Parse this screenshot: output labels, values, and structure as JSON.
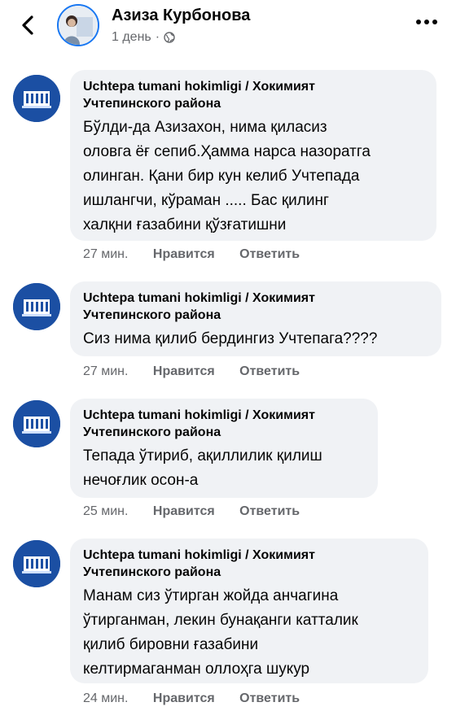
{
  "header": {
    "name": "Азиза Курбонова",
    "time": "1 день",
    "separator": "·",
    "icons": {
      "back": "chevron-left-icon",
      "privacy": "globe-icon",
      "more": "more-dots-icon"
    }
  },
  "colors": {
    "bubble": "#f0f2f5",
    "muted": "#65676b",
    "avatar": "#1b4fa3",
    "accent": "#1877f2"
  },
  "comments": [
    {
      "author": "Uchtepa tumani hokimligi / Хокимият\nУчтепинского района",
      "text": "Бўлди-да Азизахон, нима қиласиз\nоловга ёғ сепиб.Ҳамма нарса назоратга\nолинган. Қани бир кун келиб Учтепада\nишлангчи, кўраман ..... Бас қилинг\nхалқни ғазабини қўзғатишни",
      "time": "27 мин.",
      "like": "Нравится",
      "reply": "Ответить"
    },
    {
      "author": "Uchtepa tumani hokimligi / Хокимият\nУчтепинского района",
      "text": "Сиз нима қилиб бердингиз Учтепага????",
      "time": "27 мин.",
      "like": "Нравится",
      "reply": "Ответить"
    },
    {
      "author": "Uchtepa tumani hokimligi / Хокимият\nУчтепинского района",
      "text": "Тепада ўтириб, ақиллилик қилиш\nнечоғлик осон-а",
      "time": "25 мин.",
      "like": "Нравится",
      "reply": "Ответить"
    },
    {
      "author": "Uchtepa tumani hokimligi / Хокимият\nУчтепинского района",
      "text": "Манам сиз ўтирган жойда анчагина\nўтирганман, лекин бунақанги катталик\nқилиб бировни ғазабини\nкелтирмаганман оллоҳга шукур",
      "time": "24 мин.",
      "like": "Нравится",
      "reply": "Ответить"
    }
  ]
}
